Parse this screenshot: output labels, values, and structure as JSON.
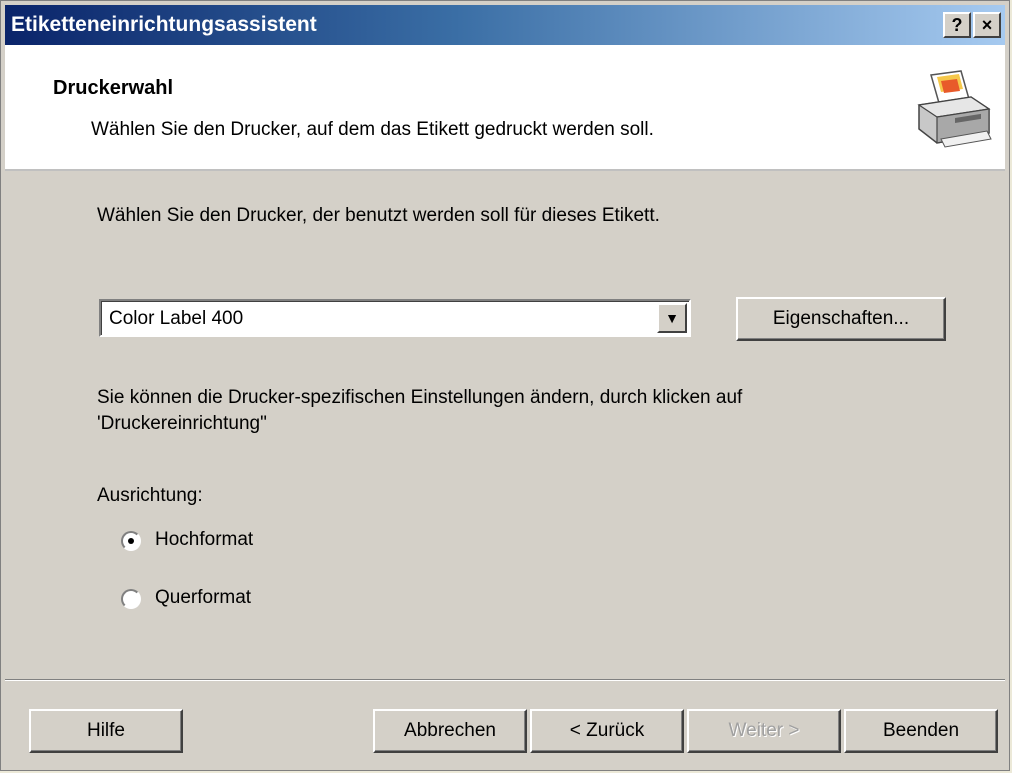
{
  "window": {
    "title": "Etiketteneinrichtungsassistent",
    "help_button": "?",
    "close_button": "×"
  },
  "header": {
    "title": "Druckerwahl",
    "subtitle": "Wählen Sie den Drucker, auf dem das Etikett gedruckt werden soll.",
    "icon": "printer-icon"
  },
  "main": {
    "intro": "Wählen Sie den Drucker, der benutzt werden soll für dieses Etikett.",
    "printer_select": {
      "selected": "Color Label 400",
      "arrow": "▼"
    },
    "properties_button": "Eigenschaften...",
    "info_line1": "Sie können die Drucker-spezifischen Einstellungen ändern, durch klicken auf",
    "info_line2": "'Druckereinrichtung\"",
    "orientation": {
      "label": "Ausrichtung:",
      "options": [
        {
          "label": "Hochformat",
          "checked": true
        },
        {
          "label": "Querformat",
          "checked": false
        }
      ]
    }
  },
  "footer": {
    "help": "Hilfe",
    "cancel": "Abbrechen",
    "back": "< Zurück",
    "next": "Weiter >",
    "finish": "Beenden"
  },
  "colors": {
    "titlebar_start": "#0a246a",
    "titlebar_end": "#a6caf0",
    "dialog_bg": "#d4d0c8",
    "disabled_text": "#a0a0a0"
  }
}
